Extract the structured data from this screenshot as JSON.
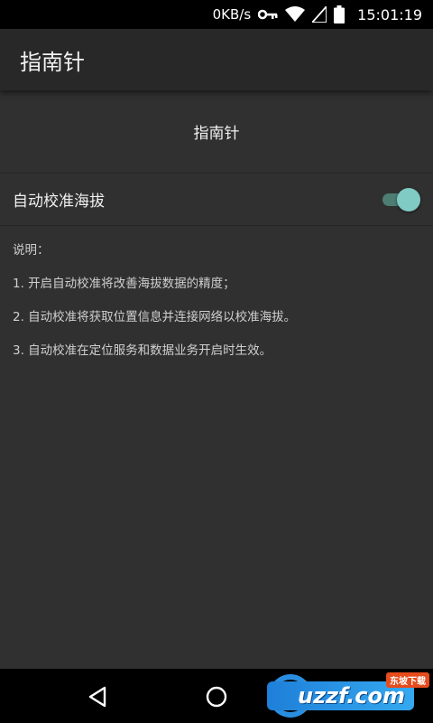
{
  "status_bar": {
    "net_speed": "0KB/s",
    "time": "15:01:19"
  },
  "app_bar": {
    "title": "指南针"
  },
  "section": {
    "header": "指南针"
  },
  "setting": {
    "label": "自动校准海拔",
    "enabled": true,
    "accent": "#80cbc4"
  },
  "notes": {
    "heading": "说明：",
    "items": [
      "1. 开启自动校准将改善海拔数据的精度；",
      "2. 自动校准将获取位置信息并连接网络以校准海拔。",
      "3. 自动校准在定位服务和数据业务开启时生效。"
    ]
  },
  "watermark": {
    "text": "uzzf.com",
    "badge": "东坡下载"
  },
  "icons": [
    "key-icon",
    "wifi-icon",
    "signal-icon",
    "battery-icon",
    "back-icon",
    "home-icon"
  ]
}
